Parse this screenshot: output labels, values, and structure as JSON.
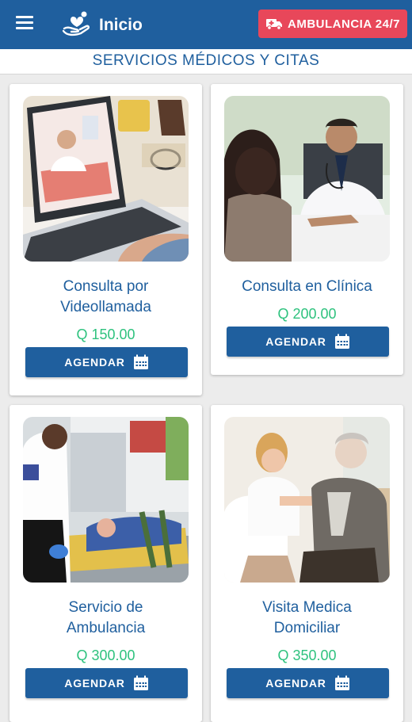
{
  "appbar": {
    "title": "Inicio",
    "ambulance_button": "AMBULANCIA 24/7",
    "colors": {
      "primary": "#1f5f9e",
      "ambulance": "#e8475a"
    }
  },
  "section_title": "SERVICIOS MÉDICOS Y CITAS",
  "services": [
    {
      "title": "Consulta por Videollamada",
      "price": "Q 150.00",
      "button": "AGENDAR",
      "image": "doctor-video-call-laptop"
    },
    {
      "title": "Consulta en Clínica",
      "price": "Q 200.00",
      "button": "AGENDAR",
      "image": "doctor-clinic-consultation"
    },
    {
      "title": "Servicio de Ambulancia",
      "price": "Q 300.00",
      "button": "AGENDAR",
      "image": "paramedic-ambulance"
    },
    {
      "title": "Visita Medica Domiciliar",
      "price": "Q 350.00",
      "button": "AGENDAR",
      "image": "doctor-home-visit"
    }
  ],
  "price_color": "#2ec27e"
}
